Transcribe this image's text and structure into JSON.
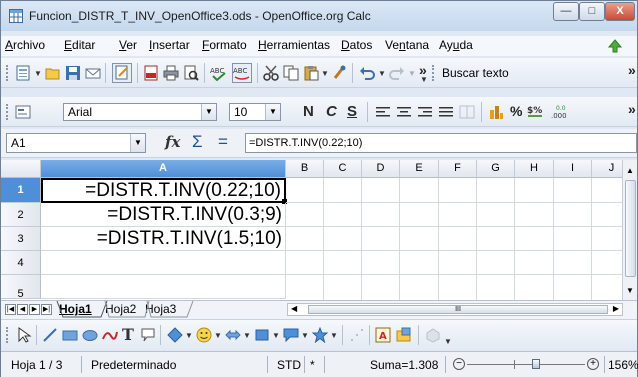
{
  "window": {
    "title": "Funcion_DISTR_T_INV_OpenOffice3.ods - OpenOffice.org Calc",
    "minimize_glyph": "—",
    "maximize_glyph": "□",
    "close_glyph": "X"
  },
  "menubar": {
    "items": [
      "Archivo",
      "Editar",
      "Ver",
      "Insertar",
      "Formato",
      "Herramientas",
      "Datos",
      "Ventana",
      "Ayuda"
    ]
  },
  "toolbar_standard": {
    "find_label": "Buscar texto",
    "overflow_glyph": "»"
  },
  "toolbar_format": {
    "font_name": "Arial",
    "font_size": "10",
    "bold_label": "N",
    "italic_label": "C",
    "underline_label": "S",
    "percent_label": "%",
    "overflow_glyph": "»"
  },
  "formula_bar": {
    "cell_ref": "A1",
    "function_wizard": "fx",
    "sum_glyph": "Σ",
    "equals_glyph": "=",
    "formula": "=DISTR.T.INV(0.22;10)"
  },
  "grid": {
    "columns": [
      "A",
      "B",
      "C",
      "D",
      "E",
      "F",
      "G",
      "H",
      "I",
      "J"
    ],
    "rows": [
      {
        "num": "1",
        "a": "=DISTR.T.INV(0.22;10)"
      },
      {
        "num": "2",
        "a": "=DISTR.T.INV(0.3;9)"
      },
      {
        "num": "3",
        "a": "=DISTR.T.INV(1.5;10)"
      },
      {
        "num": "4",
        "a": ""
      },
      {
        "num": "5",
        "a": ""
      }
    ],
    "hscroll_center": "III"
  },
  "sheets": {
    "tabs": [
      "Hoja1",
      "Hoja2",
      "Hoja3"
    ]
  },
  "statusbar": {
    "sheet": "Hoja 1 / 3",
    "style": "Predeterminado",
    "mode": "STD",
    "modified": "*",
    "sum": "Suma=1.308",
    "zoom": "156%"
  }
}
